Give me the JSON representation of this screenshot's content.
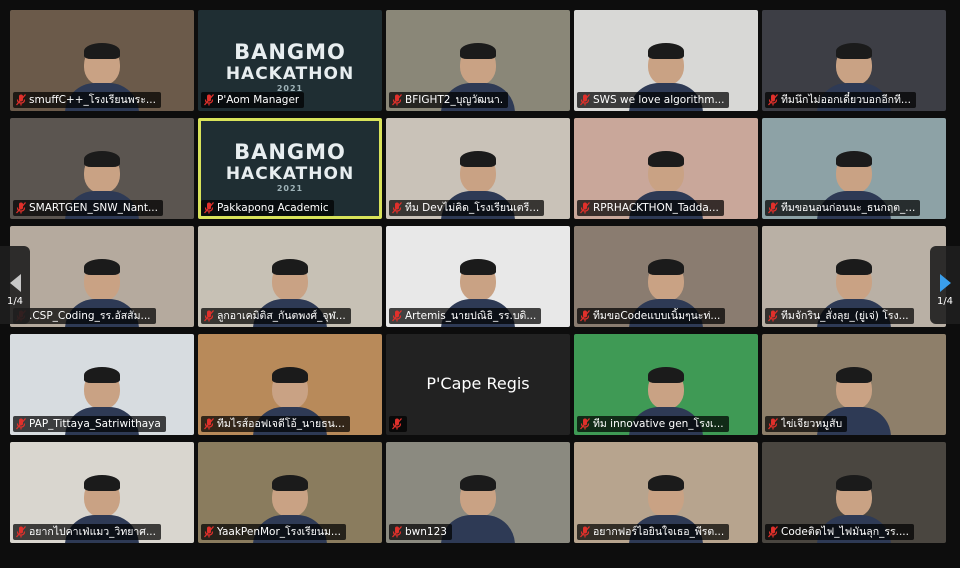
{
  "meeting": {
    "pagination": {
      "left": "1/4",
      "right": "1/4"
    },
    "hackathon_logo": {
      "line1": "BANGMO",
      "line2": "HACKATHON",
      "year": "2021"
    },
    "accent_color": "#d9e35a",
    "muted_mic_color": "#e0302b"
  },
  "participants": [
    {
      "name": "smuffC++_โรงเรียนพระ...",
      "muted": true,
      "bg": "#6b5a4a"
    },
    {
      "name": "P'Aom Manager",
      "muted": true,
      "bg": "#1f2e33",
      "logo": true
    },
    {
      "name": "BFIGHT2_บุญวัฒนา.",
      "muted": true,
      "bg": "#8a8778"
    },
    {
      "name": "SWS we love algorithm...",
      "muted": true,
      "bg": "#d8d8d6"
    },
    {
      "name": "ทีมนึกไม่ออกเดี๋ยวบอกอีกที...",
      "muted": true,
      "bg": "#3d3e45"
    },
    {
      "name": "SMARTGEN_SNW_Nant...",
      "muted": true,
      "bg": "#5b5550"
    },
    {
      "name": "Pakkapong Academic",
      "muted": true,
      "bg": "#1f2e33",
      "logo": true,
      "active": true
    },
    {
      "name": "ทีม Devไม่คิด_โรงเรียนเตรี...",
      "muted": true,
      "bg": "#c9c2b8"
    },
    {
      "name": "RPRHACKTHON_Tadda...",
      "muted": true,
      "bg": "#c9a79a"
    },
    {
      "name": "ทีมขอนอนก่อนนะ_ธนกฤต_...",
      "muted": true,
      "bg": "#8da2a6"
    },
    {
      "name": ".CSP_Coding_รร.อัสสัม...",
      "muted": true,
      "bg": "#b5aa9e"
    },
    {
      "name": "ลูกอาเคมิติส_กันตพงศ์_จุฬ...",
      "muted": true,
      "bg": "#c7c1b5"
    },
    {
      "name": "Artemis_นายปณิธิ_รร.บดิ...",
      "muted": true,
      "bg": "#e8e8e8"
    },
    {
      "name": "ทีมขอCodeแบบเนิ้มๆนะท่...",
      "muted": true,
      "bg": "#8a7c70"
    },
    {
      "name": "ทีมจักริน_สั่งลุย_(ยู่เจ่) โรง...",
      "muted": true,
      "bg": "#b9b0a5"
    },
    {
      "name": "PAP_Tittaya_Satriwithaya",
      "muted": true,
      "bg": "#d7dce0"
    },
    {
      "name": "ทีมไรส์ออฟเจดีโอ้_นายธน...",
      "muted": true,
      "bg": "#b88a5a"
    },
    {
      "name": "P'Cape Regis",
      "muted": true,
      "bg": "#222222",
      "no_video": true
    },
    {
      "name": "ทีม innovative gen_โรงเ...",
      "muted": true,
      "bg": "#3f9a55"
    },
    {
      "name": "ไข่เจียวหมูสับ",
      "muted": true,
      "bg": "#8e7f6a"
    },
    {
      "name": "อยากไปคาเฟ่แมว_วิทยาศ...",
      "muted": true,
      "bg": "#d9d6cf"
    },
    {
      "name": "YaakPenMor_โรงเรียนม...",
      "muted": true,
      "bg": "#8a7c5e"
    },
    {
      "name": "bwn123",
      "muted": true,
      "bg": "#8b8a80"
    },
    {
      "name": "อยากฟอร์ไอยินใจเธอ_พีรต...",
      "muted": true,
      "bg": "#b7a48e"
    },
    {
      "name": "Codeติดไฟ_ไฟมันลุก_รร....",
      "muted": true,
      "bg": "#4a4640"
    }
  ]
}
